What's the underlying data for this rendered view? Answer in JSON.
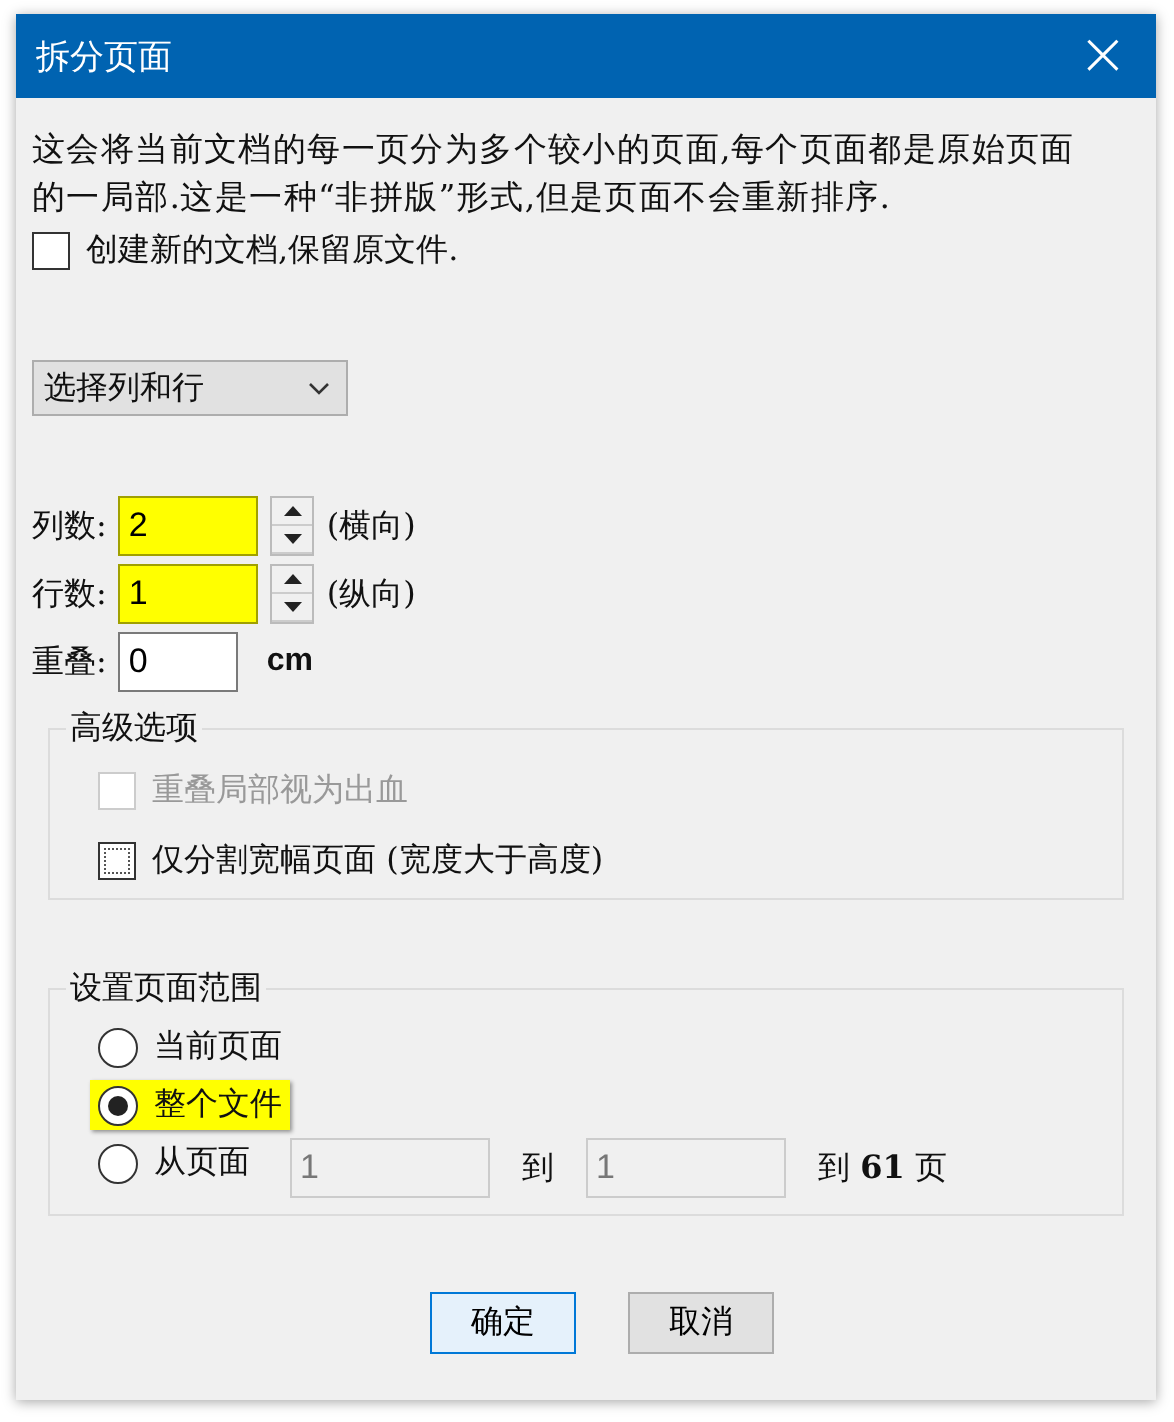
{
  "window": {
    "title": "拆分页面",
    "close": "×"
  },
  "description": "这会将当前文档的每一页分为多个较小的页面,每个页面都是原始页面的一局部.这是一种“非拼版”形式,但是页面不会重新排序.",
  "keep_original": {
    "label": "创建新的文档,保留原文件.",
    "checked": false
  },
  "mode_select": {
    "value": "选择列和行"
  },
  "grid_fields": [
    {
      "kind": "spinner",
      "label": "列数:",
      "value": "2",
      "highlighted": true,
      "suffix": "(横向)"
    },
    {
      "kind": "spinner",
      "label": "行数:",
      "value": "1",
      "highlighted": true,
      "suffix": "(纵向)"
    },
    {
      "kind": "plain",
      "label": "重叠:",
      "value": "0",
      "highlighted": false,
      "suffix": "cm"
    }
  ],
  "advanced": {
    "title": "高级选项",
    "options": [
      {
        "label": "重叠局部视为出血",
        "checked": false,
        "disabled": true,
        "focused": false
      },
      {
        "label": "仅分割宽幅页面 (宽度大于高度)",
        "checked": false,
        "disabled": false,
        "focused": true
      }
    ]
  },
  "page_range": {
    "title": "设置页面范围",
    "options": [
      {
        "label": "当前页面",
        "selected": false,
        "highlighted": false
      },
      {
        "label": "整个文件",
        "selected": true,
        "highlighted": true
      },
      {
        "label": "从页面",
        "selected": false,
        "highlighted": false
      }
    ],
    "from": "1",
    "to_label": "到",
    "to": "1",
    "total": "到 **61** 页"
  },
  "buttons": [
    {
      "label": "确定",
      "default": true
    },
    {
      "label": "取消",
      "default": false
    }
  ]
}
